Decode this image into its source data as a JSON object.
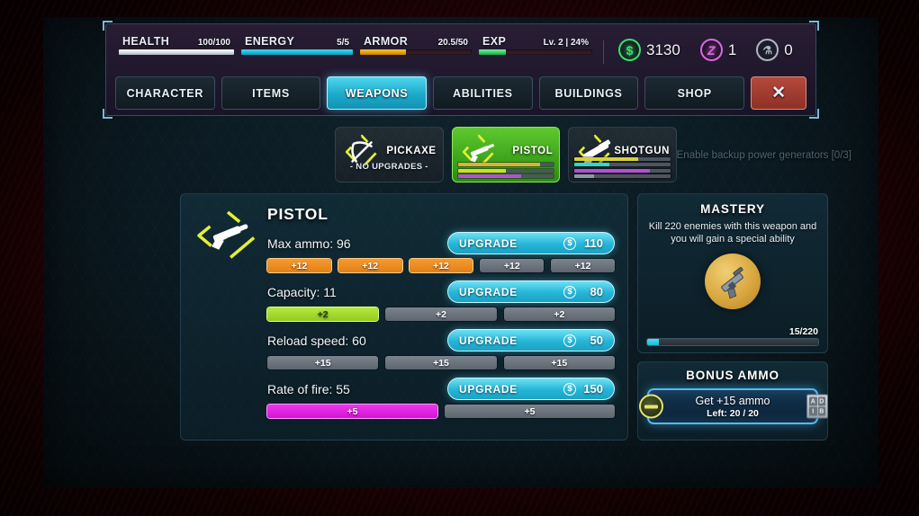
{
  "hud": {
    "stats": [
      {
        "name": "HEALTH",
        "value": "100/100",
        "pct": 100,
        "fill": "f-health"
      },
      {
        "name": "ENERGY",
        "value": "5/5",
        "pct": 100,
        "fill": "f-energy"
      },
      {
        "name": "ARMOR",
        "value": "20.5/50",
        "pct": 41,
        "fill": "f-armor"
      },
      {
        "name": "EXP",
        "value": "Lv. 2 | 24%",
        "pct": 24,
        "fill": "f-exp"
      }
    ],
    "currencies": [
      {
        "icon": "dollar-circle-icon",
        "glyph": "$",
        "cls": "ci-money",
        "value": "3130"
      },
      {
        "icon": "z-token-icon",
        "glyph": "Z",
        "cls": "ci-z",
        "value": "1"
      },
      {
        "icon": "science-flask-icon",
        "glyph": "⚗",
        "cls": "ci-sci",
        "value": "0"
      }
    ]
  },
  "tabs": [
    {
      "label": "CHARACTER",
      "active": false
    },
    {
      "label": "ITEMS",
      "active": false
    },
    {
      "label": "WEAPONS",
      "active": true
    },
    {
      "label": "ABILITIES",
      "active": false
    },
    {
      "label": "BUILDINGS",
      "active": false
    },
    {
      "label": "SHOP",
      "active": false
    }
  ],
  "close_label": "✕",
  "weapon_cards": [
    {
      "name": "PICKAXE",
      "sub": "- NO UPGRADES -",
      "selected": false,
      "bars": []
    },
    {
      "name": "PISTOL",
      "sub": "",
      "selected": true,
      "bars": [
        {
          "color": "#d8b23a",
          "pct": 86
        },
        {
          "color": "#cfe02a",
          "pct": 50
        },
        {
          "color": "#b44fd8",
          "pct": 66
        }
      ]
    },
    {
      "name": "SHOTGUN",
      "sub": "",
      "selected": false,
      "bars": [
        {
          "color": "#d8d23a",
          "pct": 66
        },
        {
          "color": "#2fd8c8",
          "pct": 36
        },
        {
          "color": "#b44fd8",
          "pct": 78
        },
        {
          "color": "#8c9aa6",
          "pct": 20
        }
      ]
    }
  ],
  "detail": {
    "title": "PISTOL",
    "upgrade_label": "UPGRADE",
    "rows": [
      {
        "stat": "Max ammo: 96",
        "cost": "110",
        "pip_label": "+12",
        "pips": 5,
        "filled": 3,
        "color": "on-orange"
      },
      {
        "stat": "Capacity: 11",
        "cost": "80",
        "pip_label": "+2",
        "pips": 3,
        "filled": 1,
        "color": "on-green"
      },
      {
        "stat": "Reload speed: 60",
        "cost": "50",
        "pip_label": "+15",
        "pips": 3,
        "filled": 0,
        "color": "on-orange"
      },
      {
        "stat": "Rate of fire: 55",
        "cost": "150",
        "pip_label": "+5",
        "pips": 2,
        "filled": 1,
        "color": "on-magenta"
      }
    ]
  },
  "mastery": {
    "title": "MASTERY",
    "description": "Kill 220 enemies with this weapon and you will gain a special ability",
    "progress_text": "15/220",
    "progress_pct": 7
  },
  "bonus": {
    "title": "BONUS AMMO",
    "action": "Get +15 ammo",
    "left": "Left: 20 / 20",
    "box_letters": [
      "A",
      "D",
      "I",
      "B"
    ]
  },
  "quest": "Enable backup power generators [0/3]"
}
